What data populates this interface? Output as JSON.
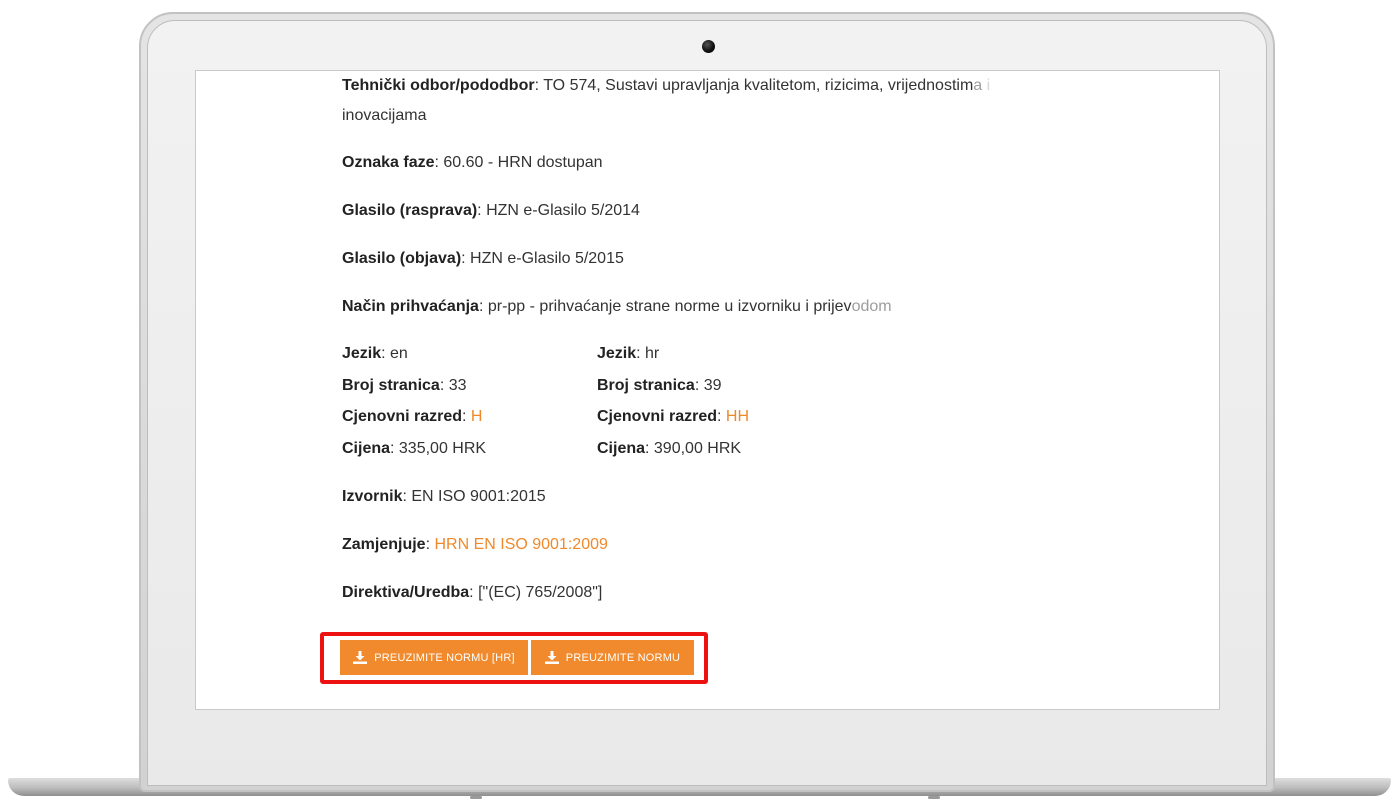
{
  "details": {
    "technical_committee": {
      "label": "Tehnički odbor/pododbor",
      "value_line1_main": "TO 574, Sustavi upravljanja kvalitetom, rizicima, vrijednostim",
      "value_line1_fade1": "a",
      "value_line1_fade2": " i",
      "value_line2": "inovacijama"
    },
    "phase_code": {
      "label": "Oznaka faze",
      "value": "60.60 - HRN dostupan"
    },
    "gazette_discussion": {
      "label": "Glasilo (rasprava)",
      "value": "HZN e-Glasilo 5/2014"
    },
    "gazette_publication": {
      "label": "Glasilo (objava)",
      "value": "HZN e-Glasilo 5/2015"
    },
    "adoption_method": {
      "label": "Način prihvaćanja",
      "value_main": "pr-pp - prihvaćanje strane norme u izvorniku i prijev",
      "value_fade": "odom"
    },
    "language_columns": [
      {
        "language_label": "Jezik",
        "language_value": "en",
        "pages_label": "Broj stranica",
        "pages_value": "33",
        "price_class_label": "Cjenovni razred",
        "price_class_value": "H",
        "price_label": "Cijena",
        "price_value": "335,00 HRK"
      },
      {
        "language_label": "Jezik",
        "language_value": "hr",
        "pages_label": "Broj stranica",
        "pages_value": "39",
        "price_class_label": "Cjenovni razred",
        "price_class_value": "HH",
        "price_label": "Cijena",
        "price_value": "390,00 HRK"
      }
    ],
    "original": {
      "label": "Izvornik",
      "value": "EN ISO 9001:2015"
    },
    "replaces": {
      "label": "Zamjenjuje",
      "value": "HRN EN ISO 9001:2009"
    },
    "directive": {
      "label": "Direktiva/Uredba",
      "value": "[\"(EC) 765/2008\"]"
    }
  },
  "buttons": {
    "download_hr": "PREUZIMITE NORMU [HR]",
    "download": "PREUZIMITE NORMU"
  },
  "colors": {
    "accent": "#f08a2c",
    "highlight": "#ee1111",
    "text": "#333333"
  },
  "icons": {
    "download": "download-icon",
    "camera": "camera-icon"
  }
}
